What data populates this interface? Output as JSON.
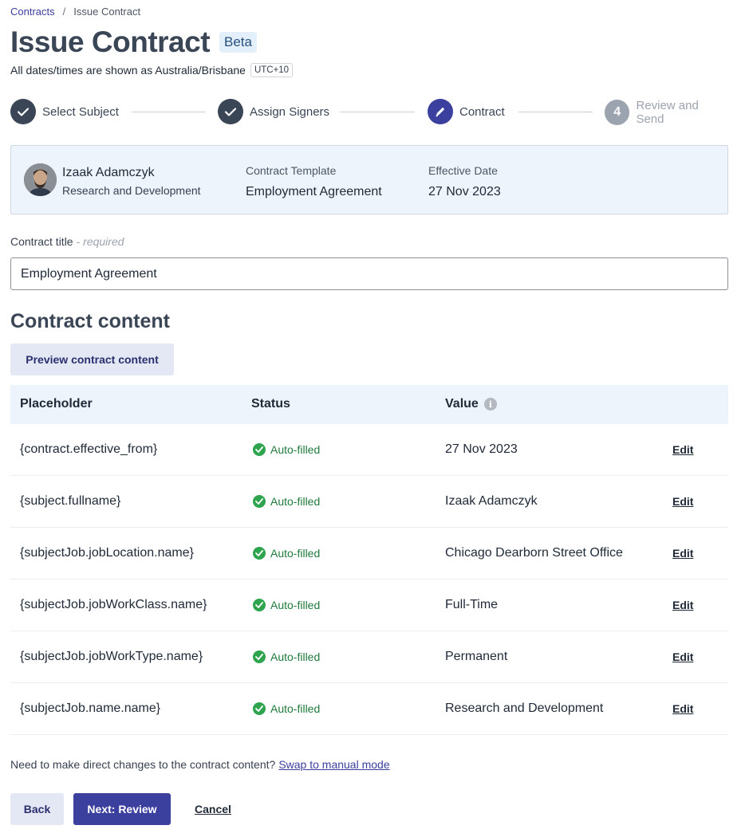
{
  "breadcrumb": {
    "root": "Contracts",
    "separator": "/",
    "current": "Issue Contract"
  },
  "header": {
    "title": "Issue Contract",
    "badge": "Beta"
  },
  "timezone": {
    "text": "All dates/times are shown as Australia/Brisbane",
    "offset": "UTC+10"
  },
  "stepper": {
    "steps": [
      {
        "number": "1",
        "label": "Select Subject",
        "state": "done"
      },
      {
        "number": "2",
        "label": "Assign Signers",
        "state": "done"
      },
      {
        "number": "3",
        "label": "Contract",
        "state": "active"
      },
      {
        "number": "4",
        "label": "Review and Send",
        "state": "todo"
      }
    ]
  },
  "subject_card": {
    "name": "Izaak Adamczyk",
    "department": "Research and Development",
    "template_label": "Contract Template",
    "template_value": "Employment Agreement",
    "date_label": "Effective Date",
    "date_value": "27 Nov 2023"
  },
  "title_field": {
    "label": "Contract title",
    "required": "- required",
    "value": "Employment Agreement"
  },
  "content": {
    "heading": "Contract content",
    "preview_button": "Preview contract content"
  },
  "table": {
    "headers": {
      "placeholder": "Placeholder",
      "status": "Status",
      "value": "Value"
    },
    "rows": [
      {
        "placeholder": "{contract.effective_from}",
        "status": "Auto-filled",
        "value": "27 Nov 2023",
        "action": "Edit"
      },
      {
        "placeholder": "{subject.fullname}",
        "status": "Auto-filled",
        "value": "Izaak Adamczyk",
        "action": "Edit"
      },
      {
        "placeholder": "{subjectJob.jobLocation.name}",
        "status": "Auto-filled",
        "value": "Chicago Dearborn Street Office",
        "action": "Edit"
      },
      {
        "placeholder": "{subjectJob.jobWorkClass.name}",
        "status": "Auto-filled",
        "value": "Full-Time",
        "action": "Edit"
      },
      {
        "placeholder": "{subjectJob.jobWorkType.name}",
        "status": "Auto-filled",
        "value": "Permanent",
        "action": "Edit"
      },
      {
        "placeholder": "{subjectJob.name.name}",
        "status": "Auto-filled",
        "value": "Research and Development",
        "action": "Edit"
      }
    ]
  },
  "manual": {
    "text": "Need to make direct changes to the contract content?",
    "link": "Swap to manual mode"
  },
  "footer": {
    "back": "Back",
    "next": "Next: Review",
    "cancel": "Cancel"
  },
  "colors": {
    "primary": "#3b3f9e",
    "success": "#2ea44f",
    "heading": "#3a4556",
    "panel": "#eef4fc"
  }
}
